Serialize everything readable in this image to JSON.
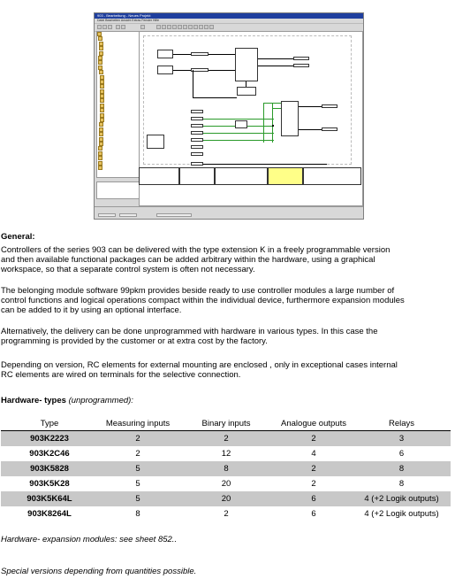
{
  "screenshot": {
    "title": "903 - Bearbeitung - Neues Projekt",
    "menu": "Datei  Bearbeiten  Ansicht  Extras  Fenster  Hilfe"
  },
  "general": {
    "heading": "General:",
    "para1": [
      "Controllers of the series 903 can be delivered with the type extension K in a freely programmable version",
      "and then available functional packages can be added arbitrary within the hardware, using a graphical",
      "workspace, so that a separate control system is often not necessary."
    ],
    "para2": [
      "The belonging module software 99pkm provides beside ready to use controller modules a large number of",
      "control functions and logical operations compact within the individual device, furthermore expansion modules",
      "can be added to it by using an optional interface."
    ],
    "para3": [
      "Alternatively, the delivery can be done unprogrammed with hardware in various types. In this case the",
      "programming is provided by the customer or at extra cost by the factory."
    ],
    "para4": [
      "Depending on version, RC elements for external mounting are enclosed , only in exceptional cases internal",
      "RC elements are wired on terminals for the selective connection."
    ]
  },
  "hardware": {
    "heading": "Hardware- types",
    "heading_suffix": "(unprogrammed):",
    "columns": [
      "Type",
      "Measuring inputs",
      "Binary inputs",
      "Analogue outputs",
      "Relays"
    ],
    "rows": [
      [
        "903K2223",
        "2",
        "2",
        "2",
        "3"
      ],
      [
        "903K2C46",
        "2",
        "12",
        "4",
        "6"
      ],
      [
        "903K5828",
        "5",
        "8",
        "2",
        "8"
      ],
      [
        "903K5K28",
        "5",
        "20",
        "2",
        "8"
      ],
      [
        "903K5K64L",
        "5",
        "20",
        "6",
        "4 (+2 Logik outputs)"
      ],
      [
        "903K8264L",
        "8",
        "2",
        "6",
        "4 (+2 Logik outputs)"
      ]
    ],
    "shaded_rows": [
      true,
      false,
      true,
      false,
      true,
      false
    ],
    "shade_color": "#c8c8c8"
  },
  "footer": {
    "expansion": "Hardware- expansion modules: see sheet 852..",
    "special": "Special versions depending from quantities possible."
  }
}
